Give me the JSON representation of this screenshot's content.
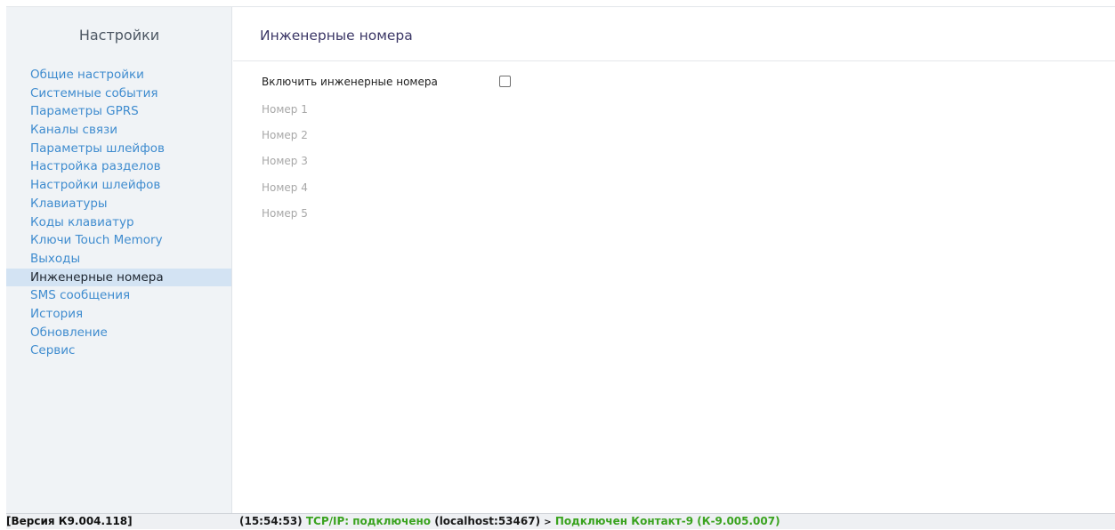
{
  "sidebar": {
    "title": "Настройки",
    "items": [
      {
        "label": "Общие настройки",
        "active": false
      },
      {
        "label": "Системные события",
        "active": false
      },
      {
        "label": "Параметры GPRS",
        "active": false
      },
      {
        "label": "Каналы связи",
        "active": false
      },
      {
        "label": "Параметры шлейфов",
        "active": false
      },
      {
        "label": "Настройка разделов",
        "active": false
      },
      {
        "label": "Настройки шлейфов",
        "active": false
      },
      {
        "label": "Клавиатуры",
        "active": false
      },
      {
        "label": "Коды клавиатур",
        "active": false
      },
      {
        "label": "Ключи Touch Memory",
        "active": false
      },
      {
        "label": "Выходы",
        "active": false
      },
      {
        "label": "Инженерные номера",
        "active": true
      },
      {
        "label": "SMS сообщения",
        "active": false
      },
      {
        "label": "История",
        "active": false
      },
      {
        "label": "Обновление",
        "active": false
      },
      {
        "label": "Сервис",
        "active": false
      }
    ]
  },
  "main": {
    "title": "Инженерные номера",
    "enable_label": "Включить инженерные номера",
    "enable_checked": false,
    "numbers": [
      "Номер 1",
      "Номер 2",
      "Номер 3",
      "Номер 4",
      "Номер 5"
    ]
  },
  "statusbar": {
    "version": "[Версия К9.004.118]",
    "time": "(15:54:53)",
    "connection_label": "TCP/IP: подключено",
    "connection_host": "(localhost:53467)",
    "separator": ">",
    "device": "Подключен Контакт-9 (К-9.005.007)"
  },
  "colors": {
    "link": "#3f8ccf",
    "active_bg": "#d3e3f3",
    "status_green": "#3aa31f",
    "title": "#3b3766"
  }
}
